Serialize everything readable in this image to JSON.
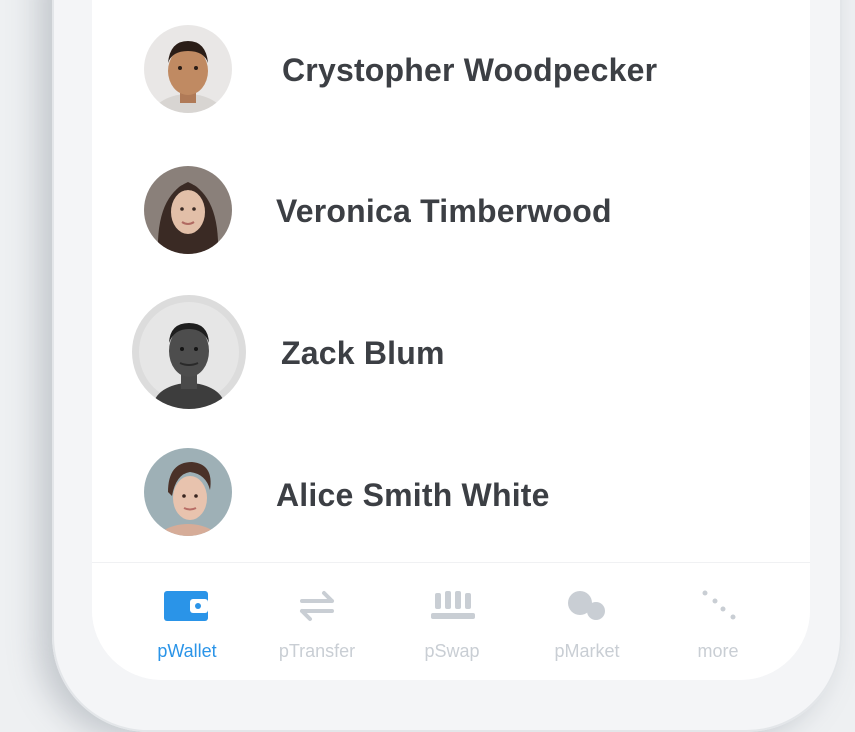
{
  "contacts": [
    {
      "name": "Crystopher Woodpecker",
      "avatar": "avatar-man-smiling"
    },
    {
      "name": "Veronica Timberwood",
      "avatar": "avatar-woman-dark-hair"
    },
    {
      "name": "Zack Blum",
      "avatar": "avatar-man-grayscale"
    },
    {
      "name": "Alice Smith White",
      "avatar": "avatar-woman-updo"
    }
  ],
  "nav": {
    "items": [
      {
        "label": "pWallet",
        "icon": "wallet-icon",
        "active": true
      },
      {
        "label": "pTransfer",
        "icon": "transfer-arrows-icon",
        "active": false
      },
      {
        "label": "pSwap",
        "icon": "swap-icon",
        "active": false
      },
      {
        "label": "pMarket",
        "icon": "market-icon",
        "active": false
      },
      {
        "label": "more",
        "icon": "more-dots-icon",
        "active": false
      }
    ]
  },
  "colors": {
    "accent": "#2a94e8",
    "inactive": "#c9ced4",
    "name_text": "#3c3f44"
  }
}
